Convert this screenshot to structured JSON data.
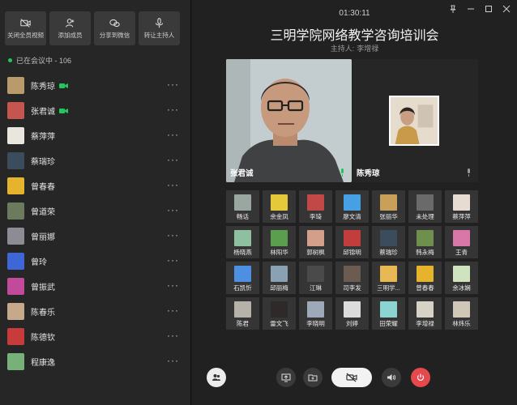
{
  "toolbar": [
    {
      "label": "关闭全员视频",
      "icon": "camera-off-icon"
    },
    {
      "label": "添加成员",
      "icon": "add-user-icon"
    },
    {
      "label": "分享到微信",
      "icon": "wechat-icon"
    },
    {
      "label": "转让主持人",
      "icon": "microphone-icon"
    }
  ],
  "status": {
    "text": "已在会议中 - 106"
  },
  "participants": [
    {
      "name": "陈秀琼",
      "video": true,
      "color": "#b99b6b"
    },
    {
      "name": "张君诚",
      "video": true,
      "color": "#c4554f"
    },
    {
      "name": "蔡萍萍",
      "video": false,
      "color": "#e9e6df"
    },
    {
      "name": "蔡瑞珍",
      "video": false,
      "color": "#3b4d5c"
    },
    {
      "name": "曾春春",
      "video": false,
      "color": "#e6b42c"
    },
    {
      "name": "曾道荣",
      "video": false,
      "color": "#6c7a5d"
    },
    {
      "name": "曾丽娜",
      "video": false,
      "color": "#8d8c95"
    },
    {
      "name": "曾玲",
      "video": false,
      "color": "#3f66d6"
    },
    {
      "name": "曾振武",
      "video": false,
      "color": "#c24a9b"
    },
    {
      "name": "陈春乐",
      "video": false,
      "color": "#c6a98b"
    },
    {
      "name": "陈德钦",
      "video": false,
      "color": "#c73b3b"
    },
    {
      "name": "程康逸",
      "video": false,
      "color": "#78b07a"
    }
  ],
  "header": {
    "time": "01:30:11",
    "title": "三明学院网络教学咨询培训会",
    "host_label": "主持人:",
    "host_name": "李增禄"
  },
  "videos": {
    "main_name": "张君诚",
    "second_name": "陈秀琼"
  },
  "grid": [
    {
      "name": "畅话",
      "color": "#9aa7a0"
    },
    {
      "name": "余金凤",
      "color": "#e5c93a"
    },
    {
      "name": "李琦",
      "color": "#c24747"
    },
    {
      "name": "廖文清",
      "color": "#46a0e3"
    },
    {
      "name": "张丽华",
      "color": "#c9a05a"
    },
    {
      "name": "未处理",
      "color": "#6a6a6a"
    },
    {
      "name": "蔡萍萍",
      "color": "#e6dcd2"
    },
    {
      "name": "杨晓燕",
      "color": "#8fbfa1"
    },
    {
      "name": "林阳华",
      "color": "#5b9e4e"
    },
    {
      "name": "郭树枫",
      "color": "#d39e8a"
    },
    {
      "name": "邱锦明",
      "color": "#c33d3d"
    },
    {
      "name": "蔡瑞珍",
      "color": "#3b4d5c"
    },
    {
      "name": "韩永梅",
      "color": "#6f8f4d"
    },
    {
      "name": "王青",
      "color": "#d877a8"
    },
    {
      "name": "石凯忻",
      "color": "#4d8fe0"
    },
    {
      "name": "邱丽梅",
      "color": "#8aa0b3"
    },
    {
      "name": "江琳",
      "color": "#4a4a4a"
    },
    {
      "name": "司李发",
      "color": "#6b5b50"
    },
    {
      "name": "三明学...",
      "color": "#e7b955"
    },
    {
      "name": "曾春春",
      "color": "#e6b42c"
    },
    {
      "name": "余冰娴",
      "color": "#cfe3c0"
    },
    {
      "name": "陈君",
      "color": "#b7b2a9"
    },
    {
      "name": "雷文飞",
      "color": "#2e2a2a"
    },
    {
      "name": "李晓明",
      "color": "#9da8b8"
    },
    {
      "name": "刘婷",
      "color": "#dcdcdc"
    },
    {
      "name": "田荣耀",
      "color": "#8bd4d1"
    },
    {
      "name": "李增禄",
      "color": "#d6d2c6"
    },
    {
      "name": "林炜乐",
      "color": "#cfc7b8"
    }
  ],
  "controls": [
    {
      "name": "participants-button",
      "icon": "users-icon"
    },
    {
      "name": "share-screen-button",
      "icon": "screen-share-icon"
    },
    {
      "name": "files-button",
      "icon": "folder-icon"
    },
    {
      "name": "camera-toggle-button",
      "icon": "camera-off-icon"
    },
    {
      "name": "speaker-button",
      "icon": "speaker-icon"
    },
    {
      "name": "end-meeting-button",
      "icon": "power-icon"
    }
  ]
}
